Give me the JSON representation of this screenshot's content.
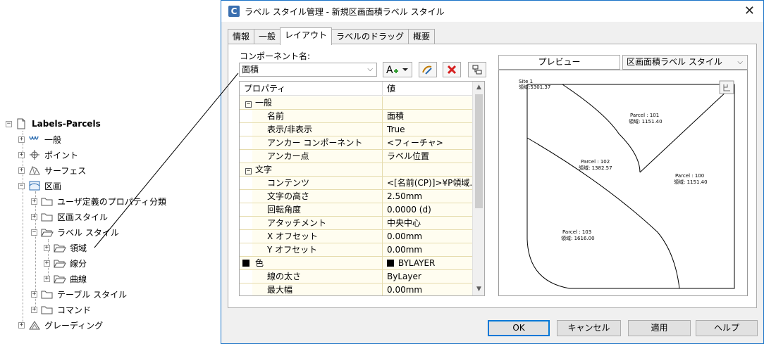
{
  "tree": {
    "root": "Labels-Parcels",
    "items": [
      {
        "label": "一般",
        "icon": "general-settings-icon"
      },
      {
        "label": "ポイント",
        "icon": "point-icon"
      },
      {
        "label": "サーフェス",
        "icon": "surface-icon"
      },
      {
        "label": "区画",
        "icon": "parcel-icon"
      },
      {
        "label": "ユーザ定義のプロパティ分類",
        "icon": "folder-icon"
      },
      {
        "label": "区画スタイル",
        "icon": "folder-icon"
      },
      {
        "label": "ラベル スタイル",
        "icon": "folder-icon"
      },
      {
        "label": "領域",
        "icon": "folder-icon"
      },
      {
        "label": "線分",
        "icon": "folder-icon"
      },
      {
        "label": "曲線",
        "icon": "folder-icon"
      },
      {
        "label": "テーブル スタイル",
        "icon": "folder-icon"
      },
      {
        "label": "コマンド",
        "icon": "folder-icon"
      },
      {
        "label": "グレーディング",
        "icon": "grading-icon"
      }
    ]
  },
  "dialog": {
    "title": "ラベル スタイル管理 - 新規区画面積ラベル スタイル",
    "app_icon": "C",
    "close": "✕",
    "tabs": [
      "情報",
      "一般",
      "レイアウト",
      "ラベルのドラッグ",
      "概要"
    ],
    "active_tab": "レイアウト",
    "component_label": "コンポーネント名:",
    "component_value": "面積",
    "grid": {
      "headers": [
        "プロパティ",
        "値"
      ],
      "rows": [
        {
          "cat": true,
          "prop": "一般",
          "val": ""
        },
        {
          "prop": "名前",
          "val": "面積"
        },
        {
          "prop": "表示/非表示",
          "val": "True"
        },
        {
          "prop": "アンカー コンポーネント",
          "val": "<フィーチャ>"
        },
        {
          "prop": "アンカー点",
          "val": "ラベル位置"
        },
        {
          "cat": true,
          "prop": "文字",
          "val": ""
        },
        {
          "prop": "コンテンツ",
          "val": "<[名前(CP)]>¥P領域..."
        },
        {
          "prop": "文字の高さ",
          "val": "2.50mm"
        },
        {
          "prop": "回転角度",
          "val": "0.0000 (d)"
        },
        {
          "prop": "アタッチメント",
          "val": "中央中心"
        },
        {
          "prop": "X オフセット",
          "val": "0.00mm"
        },
        {
          "prop": "Y オフセット",
          "val": "0.00mm"
        },
        {
          "prop": "色",
          "val": "BYLAYER",
          "swatch": true
        },
        {
          "prop": "線の太さ",
          "val": "ByLayer"
        },
        {
          "prop": "最大幅",
          "val": "0.00mm"
        }
      ]
    },
    "preview_tab": "プレビュー",
    "preview_select": "区画面積ラベル スタイル",
    "preview_labels": {
      "site": "Site 1",
      "site_area": "領域:5301.37",
      "p101a": "Parcel : 101",
      "p101b": "領域: 1151.40",
      "p102a": "Parcel : 102",
      "p102b": "領域: 1382.57",
      "p100a": "Parcel : 100",
      "p100b": "領域: 1151.40",
      "p103a": "Parcel : 103",
      "p103b": "領域: 1616.00"
    },
    "buttons": {
      "ok": "OK",
      "cancel": "キャンセル",
      "apply": "適用",
      "help": "ヘルプ"
    }
  }
}
